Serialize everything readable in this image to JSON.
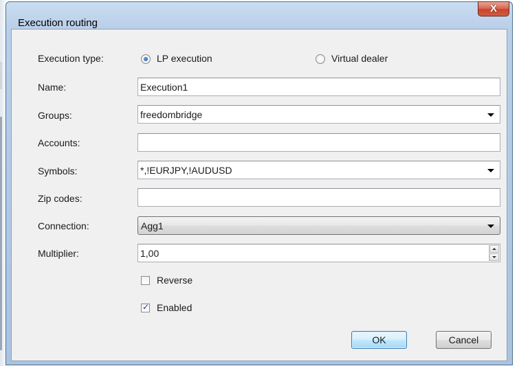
{
  "window": {
    "title": "Execution routing",
    "close_glyph": "X"
  },
  "form": {
    "execution_type": {
      "label": "Execution type:",
      "options": [
        {
          "label": "LP execution",
          "selected": true
        },
        {
          "label": "Virtual dealer",
          "selected": false
        }
      ]
    },
    "name": {
      "label": "Name:",
      "value": "Execution1"
    },
    "groups": {
      "label": "Groups:",
      "value": "freedombridge"
    },
    "accounts": {
      "label": "Accounts:",
      "value": ""
    },
    "symbols": {
      "label": "Symbols:",
      "value": "*,!EURJPY,!AUDUSD"
    },
    "zip_codes": {
      "label": "Zip codes:",
      "value": ""
    },
    "connection": {
      "label": "Connection:",
      "value": "Agg1"
    },
    "multiplier": {
      "label": "Multiplier:",
      "value": "1,00"
    },
    "reverse": {
      "label": "Reverse",
      "checked": false
    },
    "enabled": {
      "label": "Enabled",
      "checked": true,
      "check_glyph": "✓"
    }
  },
  "buttons": {
    "ok": "OK",
    "cancel": "Cancel"
  },
  "colors": {
    "title_bar": "#b9cfe8",
    "close_button": "#c6442d",
    "default_button": "#bee6fd"
  }
}
